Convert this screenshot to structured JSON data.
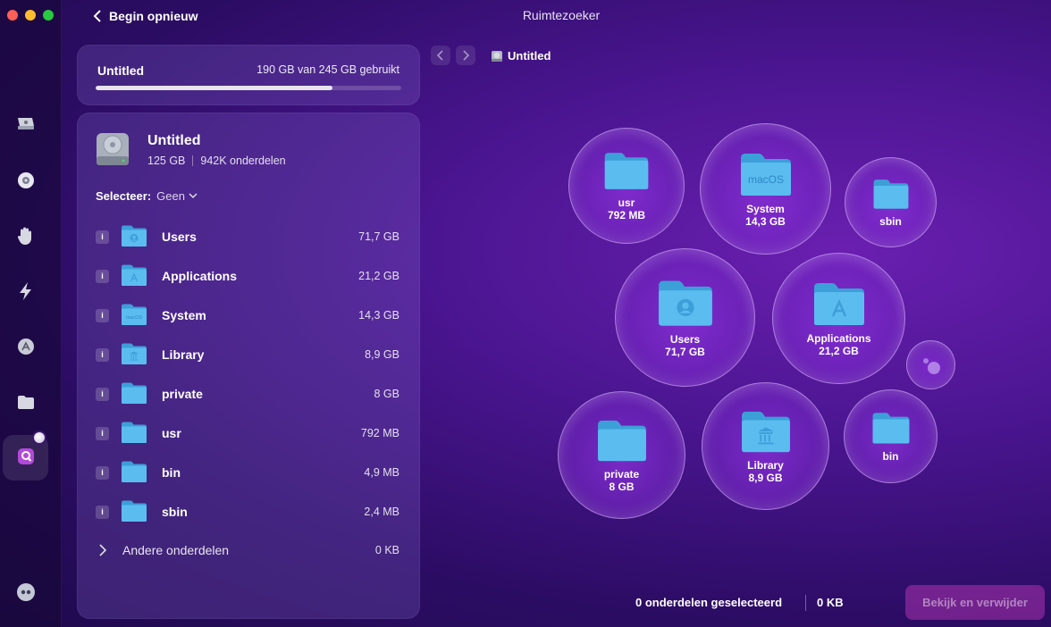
{
  "window": {
    "title": "Ruimtezoeker",
    "back_label": "Begin opnieuw"
  },
  "usage": {
    "volume": "Untitled",
    "text": "190 GB van 245 GB gebruikt",
    "fraction_used": 0.7755
  },
  "disk": {
    "name": "Untitled",
    "size": "125 GB",
    "items": "942K onderdelen"
  },
  "select": {
    "label": "Selecteer:",
    "value": "Geen"
  },
  "list": [
    {
      "name": "Users",
      "size": "71,7 GB",
      "info": "i",
      "icon": "users-folder-icon"
    },
    {
      "name": "Applications",
      "size": "21,2 GB",
      "info": "i",
      "icon": "applications-folder-icon"
    },
    {
      "name": "System",
      "size": "14,3 GB",
      "info": "i",
      "icon": "macos-folder-icon"
    },
    {
      "name": "Library",
      "size": "8,9 GB",
      "info": "i",
      "icon": "library-folder-icon"
    },
    {
      "name": "private",
      "size": "8 GB",
      "info": "i",
      "icon": "folder-icon"
    },
    {
      "name": "usr",
      "size": "792 MB",
      "info": "i",
      "icon": "folder-icon"
    },
    {
      "name": "bin",
      "size": "4,9 MB",
      "info": "i",
      "icon": "folder-icon"
    },
    {
      "name": "sbin",
      "size": "2,4 MB",
      "info": "i",
      "icon": "folder-icon"
    }
  ],
  "other": {
    "name": "Andere onderdelen",
    "size": "0 KB"
  },
  "breadcrumb": {
    "current": "Untitled"
  },
  "bubbles": [
    {
      "name": "usr",
      "size": "792 MB",
      "icon": "folder-icon"
    },
    {
      "name": "System",
      "size": "14,3 GB",
      "icon": "macos-folder-icon",
      "badge": "macOS"
    },
    {
      "name": "sbin",
      "icon": "folder-icon"
    },
    {
      "name": "Users",
      "size": "71,7 GB",
      "icon": "users-folder-icon"
    },
    {
      "name": "Applications",
      "size": "21,2 GB",
      "icon": "applications-folder-icon"
    },
    {
      "name": "private",
      "size": "8 GB",
      "icon": "folder-icon"
    },
    {
      "name": "Library",
      "size": "8,9 GB",
      "icon": "library-folder-icon"
    },
    {
      "name": "bin",
      "icon": "folder-icon"
    }
  ],
  "footer": {
    "selected": "0 onderdelen geselecteerd",
    "selected_size": "0 KB",
    "action": "Bekijk en verwijder"
  },
  "colors": {
    "folder": "#5bbcf0",
    "folder_dark": "#3d9fd8",
    "accent": "#c83cbe"
  }
}
